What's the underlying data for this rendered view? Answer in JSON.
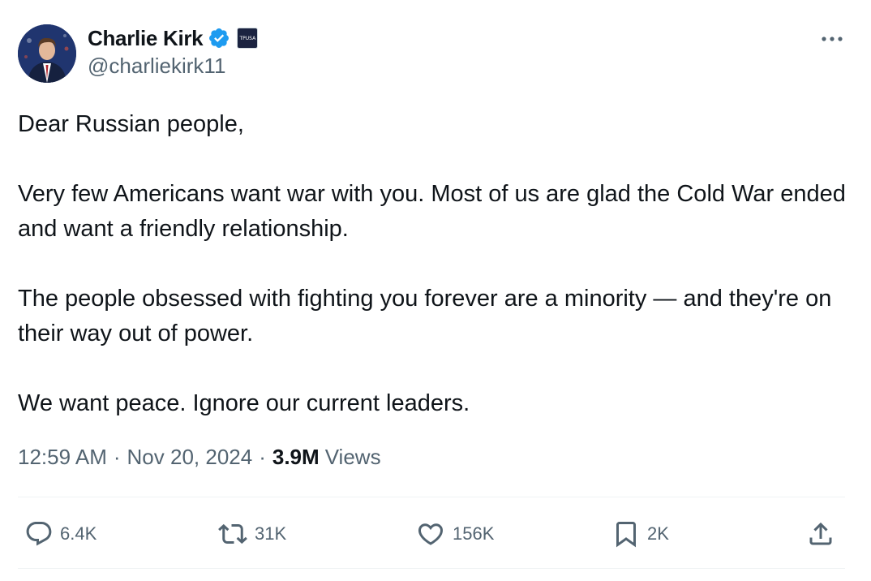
{
  "author": {
    "display_name": "Charlie Kirk",
    "handle": "@charliekirk11",
    "verified": true,
    "affiliate_badge_text": "TPUSA"
  },
  "tweet": {
    "paragraphs": [
      "Dear Russian people,",
      "Very few Americans want war with you. Most of us are glad the Cold War ended and want a friendly relationship.",
      "The people obsessed with fighting you forever are a minority — and they're on their way out of power.",
      "We want peace. Ignore our current leaders."
    ]
  },
  "meta": {
    "time": "12:59 AM",
    "separator": "·",
    "date": "Nov 20, 2024",
    "views_count": "3.9M",
    "views_label": "Views"
  },
  "actions": {
    "reply": {
      "icon": "reply-icon",
      "count": "6.4K"
    },
    "repost": {
      "icon": "repost-icon",
      "count": "31K"
    },
    "like": {
      "icon": "heart-icon",
      "count": "156K"
    },
    "bookmark": {
      "icon": "bookmark-icon",
      "count": "2K"
    },
    "share": {
      "icon": "share-icon"
    }
  },
  "colors": {
    "text_primary": "#0f1419",
    "text_secondary": "#536471",
    "verified_blue": "#1d9bf0",
    "divider": "#eff3f4"
  }
}
